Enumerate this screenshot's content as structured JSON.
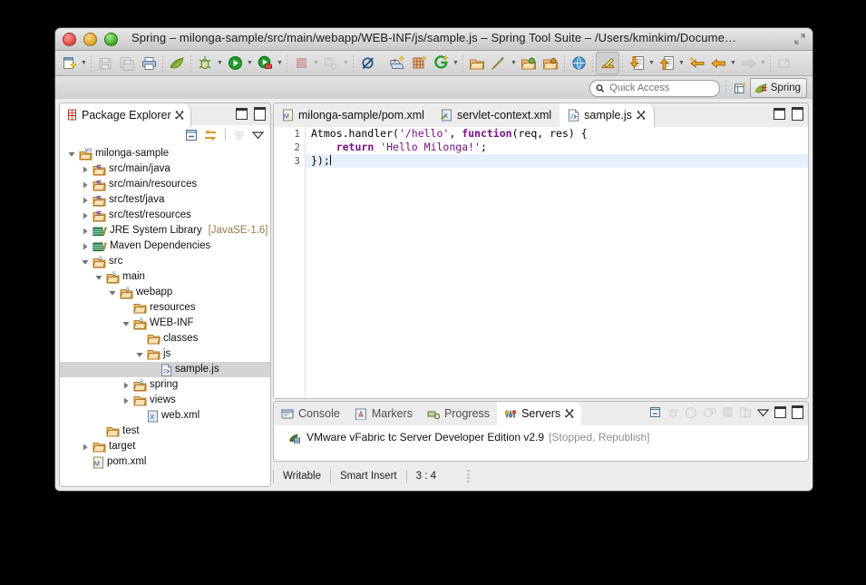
{
  "window": {
    "title": "Spring – milonga-sample/src/main/webapp/WEB-INF/js/sample.js – Spring Tool Suite – /Users/kminkim/Docume…",
    "traffic": {
      "close": "close-button",
      "minimize": "minimize-button",
      "zoom": "zoom-button"
    }
  },
  "toolbar": {
    "items": [
      {
        "name": "new-wizard",
        "arrow": true
      },
      {
        "name": "save",
        "arrow": false
      },
      {
        "name": "save-all",
        "arrow": false
      },
      {
        "name": "print",
        "arrow": false
      },
      {
        "name": "spring-leaf",
        "arrow": false
      },
      {
        "name": "debug",
        "arrow": true
      },
      {
        "name": "run",
        "arrow": true
      },
      {
        "name": "run-server",
        "arrow": true
      },
      {
        "name": "terminate",
        "arrow": true
      },
      {
        "name": "disconnect",
        "arrow": true
      },
      {
        "name": "skip-breakpoints",
        "arrow": false
      },
      {
        "name": "new-java-class",
        "arrow": false
      },
      {
        "name": "new-grid",
        "arrow": false
      },
      {
        "name": "new-git",
        "arrow": true
      },
      {
        "name": "open-type",
        "arrow": false
      },
      {
        "name": "open-task",
        "arrow": true
      },
      {
        "name": "open-resource",
        "arrow": false
      },
      {
        "name": "open-package",
        "arrow": false
      },
      {
        "name": "open-web-browser",
        "arrow": false
      },
      {
        "name": "pencil-highlight",
        "arrow": false
      },
      {
        "name": "download-update",
        "arrow": true
      },
      {
        "name": "upload-publish",
        "arrow": true
      },
      {
        "name": "next-annotation",
        "arrow": false
      },
      {
        "name": "back",
        "arrow": true
      },
      {
        "name": "forward",
        "arrow": true
      },
      {
        "name": "restore-view",
        "arrow": false
      }
    ]
  },
  "quick_access": {
    "placeholder": "Quick Access",
    "value": "",
    "perspective_switch_label": "",
    "perspective_label": "Spring"
  },
  "package_explorer": {
    "tab_label": "Package Explorer",
    "toolbar": [
      "collapse-all-icon",
      "link-with-editor-icon",
      "view-menu-icon"
    ],
    "tree": [
      {
        "label": "milonga-sample",
        "indent": 0,
        "twisty": "down",
        "icon": "project-maven",
        "selected": false
      },
      {
        "label": "src/main/java",
        "indent": 1,
        "twisty": "right",
        "icon": "source-folder",
        "selected": false
      },
      {
        "label": "src/main/resources",
        "indent": 1,
        "twisty": "right",
        "icon": "source-folder",
        "selected": false
      },
      {
        "label": "src/test/java",
        "indent": 1,
        "twisty": "right",
        "icon": "source-folder",
        "selected": false
      },
      {
        "label": "src/test/resources",
        "indent": 1,
        "twisty": "right",
        "icon": "source-folder",
        "selected": false
      },
      {
        "label": "JRE System Library",
        "indent": 1,
        "twisty": "right",
        "icon": "library",
        "selected": false,
        "suffix": "[JavaSE-1.6]"
      },
      {
        "label": "Maven Dependencies",
        "indent": 1,
        "twisty": "right",
        "icon": "library",
        "selected": false
      },
      {
        "label": "src",
        "indent": 1,
        "twisty": "down",
        "icon": "folder-svn",
        "selected": false
      },
      {
        "label": "main",
        "indent": 2,
        "twisty": "down",
        "icon": "folder-svn",
        "selected": false
      },
      {
        "label": "webapp",
        "indent": 3,
        "twisty": "down",
        "icon": "folder-svn",
        "selected": false
      },
      {
        "label": "resources",
        "indent": 4,
        "twisty": "none",
        "icon": "folder",
        "selected": false
      },
      {
        "label": "WEB-INF",
        "indent": 4,
        "twisty": "down",
        "icon": "folder-svn",
        "selected": false
      },
      {
        "label": "classes",
        "indent": 5,
        "twisty": "none",
        "icon": "folder",
        "selected": false
      },
      {
        "label": "js",
        "indent": 5,
        "twisty": "down",
        "icon": "folder",
        "selected": false
      },
      {
        "label": "sample.js",
        "indent": 6,
        "twisty": "none",
        "icon": "js-file",
        "selected": true
      },
      {
        "label": "spring",
        "indent": 4,
        "twisty": "right",
        "icon": "folder-svn",
        "selected": false
      },
      {
        "label": "views",
        "indent": 4,
        "twisty": "right",
        "icon": "folder",
        "selected": false
      },
      {
        "label": "web.xml",
        "indent": 5,
        "twisty": "none",
        "icon": "xml-file",
        "selected": false
      },
      {
        "label": "test",
        "indent": 2,
        "twisty": "none",
        "icon": "folder",
        "selected": false
      },
      {
        "label": "target",
        "indent": 1,
        "twisty": "right",
        "icon": "folder",
        "selected": false
      },
      {
        "label": "pom.xml",
        "indent": 1,
        "twisty": "none",
        "icon": "maven-file",
        "selected": false
      }
    ]
  },
  "editor": {
    "tabs": [
      {
        "label": "milonga-sample/pom.xml",
        "icon": "maven-file",
        "active": false,
        "closable": false
      },
      {
        "label": "servlet-context.xml",
        "icon": "spring-xml-file",
        "active": false,
        "closable": false
      },
      {
        "label": "sample.js",
        "icon": "js-file",
        "active": true,
        "closable": true
      }
    ],
    "line_numbers": [
      "1",
      "2",
      "3"
    ],
    "code_lines": [
      {
        "tokens": [
          {
            "t": "Atmos.handler(",
            "c": "plain"
          },
          {
            "t": "'/hello'",
            "c": "string"
          },
          {
            "t": ", ",
            "c": "plain"
          },
          {
            "t": "function",
            "c": "keyword"
          },
          {
            "t": "(req, res) {",
            "c": "plain"
          }
        ],
        "current": false
      },
      {
        "tokens": [
          {
            "t": "    ",
            "c": "plain"
          },
          {
            "t": "return",
            "c": "keyword"
          },
          {
            "t": " ",
            "c": "plain"
          },
          {
            "t": "'Hello Milonga!'",
            "c": "string"
          },
          {
            "t": ";",
            "c": "plain"
          }
        ],
        "current": false
      },
      {
        "tokens": [
          {
            "t": "});",
            "c": "plain"
          }
        ],
        "current": true,
        "caret": true
      }
    ]
  },
  "bottom_panel": {
    "tabs": [
      {
        "label": "Console",
        "icon": "console-icon",
        "active": false,
        "closable": false
      },
      {
        "label": "Markers",
        "icon": "markers-icon",
        "active": false,
        "closable": false
      },
      {
        "label": "Progress",
        "icon": "progress-icon",
        "active": false,
        "closable": false
      },
      {
        "label": "Servers",
        "icon": "servers-icon",
        "active": true,
        "closable": true
      }
    ],
    "toolbar": [
      "collapse-all-icon",
      "debug-server-icon",
      "start-server-icon",
      "profile-server-icon",
      "stop-server-icon",
      "publish-icon",
      "view-menu-icon"
    ],
    "servers": [
      {
        "name": "VMware vFabric tc Server Developer Edition v2.9",
        "state": "[Stopped, Republish]"
      }
    ]
  },
  "status_bar": {
    "writable": "Writable",
    "insert_mode": "Smart Insert",
    "position": "3 : 4"
  },
  "colors": {
    "string": "#7a0f8a",
    "keyword": "#7a0f8a",
    "selection": "#d4d4d4",
    "current_line": "#e8f1fb",
    "state_text": "#8c8c8c",
    "jre_suffix": "#9a7b45"
  }
}
